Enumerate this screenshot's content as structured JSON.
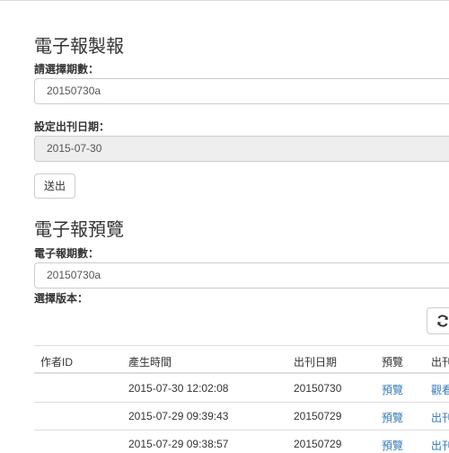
{
  "produce": {
    "heading": "電子報製報",
    "issue_label": "請選擇期數：",
    "issue_value": "20150730a",
    "date_label": "設定出刊日期：",
    "date_value": "2015-07-30",
    "submit_label": "送出"
  },
  "preview": {
    "heading": "電子報預覽",
    "issue_label": "電子報期數：",
    "issue_value": "20150730a",
    "version_label": "選擇版本：",
    "refresh_icon": "refresh-icon"
  },
  "table": {
    "columns": [
      "作者ID",
      "產生時間",
      "出刊日期",
      "預覽",
      "出刊"
    ],
    "rows": [
      {
        "author": "",
        "created": "2015-07-30 12:02:08",
        "pub_date": "20150730",
        "preview": "預覽",
        "publish": "觀看"
      },
      {
        "author": "",
        "created": "2015-07-29 09:39:43",
        "pub_date": "20150729",
        "preview": "預覽",
        "publish": "出刊"
      },
      {
        "author": "",
        "created": "2015-07-29 09:38:57",
        "pub_date": "20150729",
        "preview": "預覽",
        "publish": "出刊"
      }
    ]
  },
  "colors": {
    "link": "#337ab7",
    "disabled_bg": "#eeeeee",
    "border": "#cccccc"
  }
}
